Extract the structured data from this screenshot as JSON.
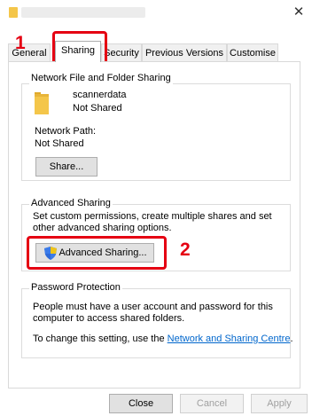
{
  "tabs": [
    {
      "label": "General"
    },
    {
      "label": "Sharing"
    },
    {
      "label": "Security"
    },
    {
      "label": "Previous Versions"
    },
    {
      "label": "Customise"
    }
  ],
  "network_sharing": {
    "legend": "Network File and Folder Sharing",
    "folder_name": "scannerdata",
    "folder_status": "Not Shared",
    "network_path_label": "Network Path:",
    "network_path_value": "Not Shared",
    "share_button": "Share..."
  },
  "advanced_sharing": {
    "legend": "Advanced Sharing",
    "description": "Set custom permissions, create multiple shares and set other advanced sharing options.",
    "button": "Advanced Sharing..."
  },
  "password_protection": {
    "legend": "Password Protection",
    "description": "People must have a user account and password for this computer to access shared folders.",
    "change_prefix": "To change this setting, use the ",
    "link": "Network and Sharing Centre",
    "change_suffix": "."
  },
  "footer": {
    "close": "Close",
    "cancel": "Cancel",
    "apply": "Apply"
  },
  "callouts": {
    "step1": "1",
    "step2": "2"
  },
  "colors": {
    "callout_red": "#e50012",
    "folder_yellow": "#f4c64a",
    "link_blue": "#0066cc"
  },
  "icons": {
    "title": "folder-icon",
    "folder": "folder-icon",
    "shield": "uac-shield-icon",
    "close": "close-icon"
  }
}
